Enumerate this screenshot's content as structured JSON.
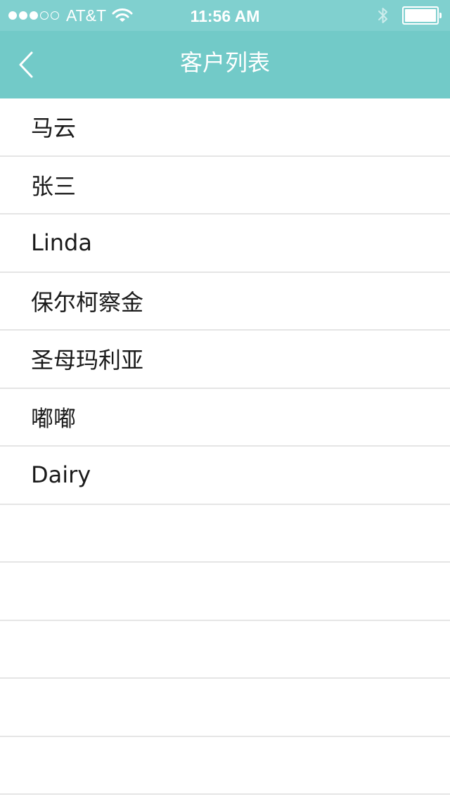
{
  "status_bar": {
    "carrier": "AT&T",
    "time": "11:56 AM",
    "signal_bars_filled": 3,
    "signal_bars_total": 5,
    "battery_level": 1.0,
    "icons": [
      "signal-dots-icon",
      "wifi-icon",
      "bluetooth-icon",
      "battery-icon"
    ]
  },
  "nav": {
    "title": "客户列表",
    "back_icon": "chevron-left-icon"
  },
  "customers": [
    "马云",
    "张三",
    "Linda",
    "保尔柯察金",
    "圣母玛利亚",
    "嘟嘟",
    "Dairy"
  ],
  "empty_rows": 5,
  "colors": {
    "status_bar_bg": "#80d0cf",
    "nav_bar_bg": "#72cac8",
    "separator": "#e5e5e5",
    "text": "#1a1a1a"
  }
}
